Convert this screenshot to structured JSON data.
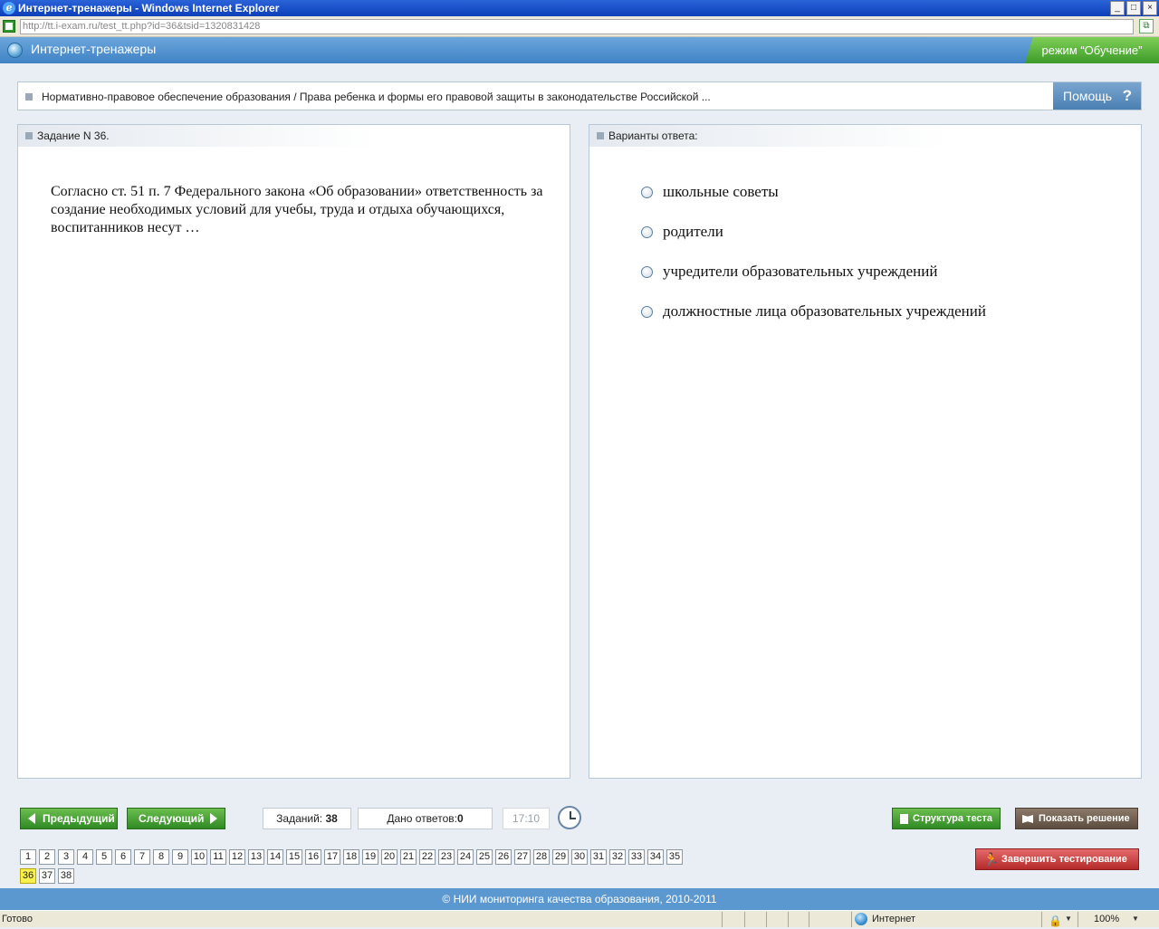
{
  "window": {
    "title": "Интернет-тренажеры - Windows Internet Explorer",
    "url": "http://tt.i-exam.ru/test_tt.php?id=36&tsid=1320831428",
    "controls": [
      "_",
      "□",
      "×"
    ]
  },
  "app": {
    "name": "Интернет-тренажеры",
    "mode": "режим “Обучение”"
  },
  "breadcrumb": {
    "text": "Нормативно-правовое обеспечение образования / Права ребенка и формы его правовой защиты в законодательстве Российской ...",
    "help_label": "Помощь",
    "help_icon": "?"
  },
  "task": {
    "header": "Задание N 36.",
    "question": "Согласно ст. 51 п. 7 Федерального закона «Об образовании» ответственность за создание необходимых условий для учебы, труда и отдыха обучающихся, воспитанников несут …"
  },
  "answers": {
    "header": "Варианты ответа:",
    "options": [
      "школьные советы",
      "родители",
      "учредители образовательных учреждений",
      "должностные лица образовательных учреждений"
    ]
  },
  "nav": {
    "prev_label": "Предыдущий",
    "next_label": "Следующий",
    "tasks_label": "Заданий:",
    "tasks_count": "38",
    "answers_label": "Дано ответов:",
    "answers_count": "0",
    "timer": "17:10",
    "structure_label": "Структура теста",
    "solution_label": "Показать решение",
    "finish_label": "Завершить тестирование"
  },
  "task_numbers": {
    "current": "36",
    "items": [
      "1",
      "2",
      "3",
      "4",
      "5",
      "6",
      "7",
      "8",
      "9",
      "10",
      "11",
      "12",
      "13",
      "14",
      "15",
      "16",
      "17",
      "18",
      "19",
      "20",
      "21",
      "22",
      "23",
      "24",
      "25",
      "26",
      "27",
      "28",
      "29",
      "30",
      "31",
      "32",
      "33",
      "34",
      "35",
      "36",
      "37",
      "38"
    ]
  },
  "footer": {
    "copyright": "© НИИ мониторинга качества образования, 2010-2011"
  },
  "statusbar": {
    "status": "Готово",
    "zone": "Интернет",
    "zoom": "100%"
  },
  "colors": {
    "header_blue": "#3f82c4",
    "mode_green": "#3d9a2a",
    "nav_green": "#2f8a24",
    "finish_red": "#b52a2a",
    "current_task_yellow": "#f8f04c"
  }
}
